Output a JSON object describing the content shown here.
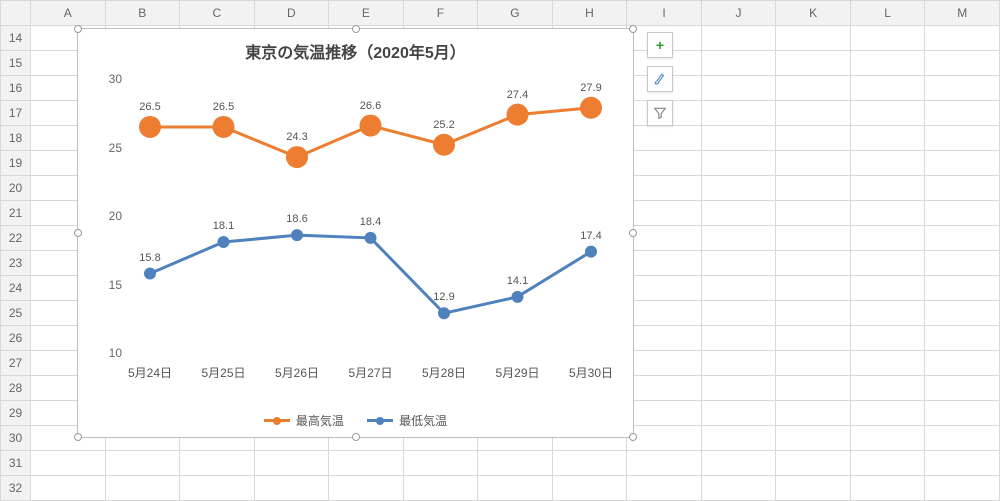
{
  "columns": [
    "A",
    "B",
    "C",
    "D",
    "E",
    "F",
    "G",
    "H",
    "I",
    "J",
    "K",
    "L",
    "M"
  ],
  "startRow": 14,
  "endRow": 32,
  "chart_data": {
    "type": "line",
    "title": "東京の気温推移（2020年5月）",
    "categories": [
      "5月24日",
      "5月25日",
      "5月26日",
      "5月27日",
      "5月28日",
      "5月29日",
      "5月30日"
    ],
    "series": [
      {
        "name": "最高気温",
        "values": [
          26.5,
          26.5,
          24.3,
          26.6,
          25.2,
          27.4,
          27.9
        ],
        "color": "#ed7d31"
      },
      {
        "name": "最低気温",
        "values": [
          15.8,
          18.1,
          18.6,
          18.4,
          12.9,
          14.1,
          17.4
        ],
        "color": "#4f81bd"
      }
    ],
    "ylim": [
      10,
      30
    ],
    "yticks": [
      10,
      15,
      20,
      25,
      30
    ],
    "xlabel": "",
    "ylabel": "",
    "legend_position": "bottom",
    "grid": false
  },
  "side_buttons": [
    {
      "name": "chart-elements-button",
      "glyph": "+"
    },
    {
      "name": "chart-styles-button",
      "glyph": "brush"
    },
    {
      "name": "chart-filter-button",
      "glyph": "funnel"
    }
  ]
}
